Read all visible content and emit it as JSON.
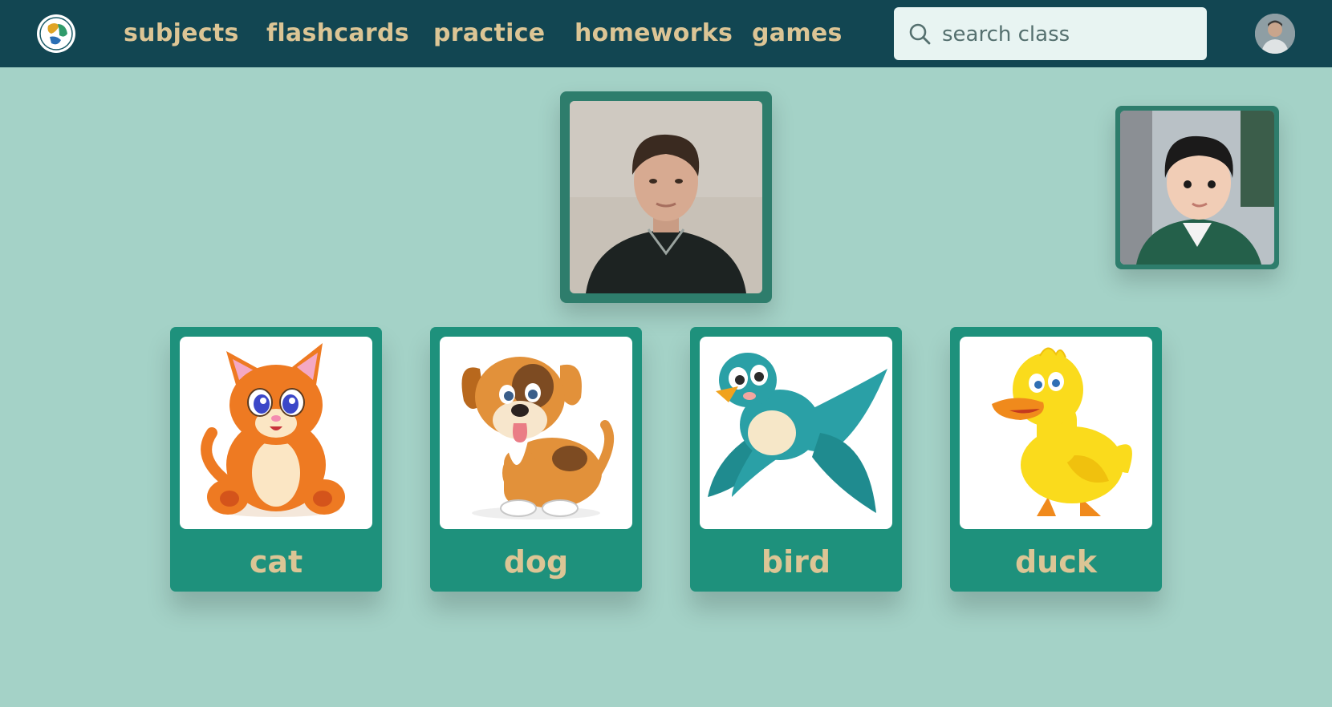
{
  "nav": {
    "logo_icon": "globe-logo-icon",
    "items": [
      {
        "label": "subjects"
      },
      {
        "label": "flashcards"
      },
      {
        "label": "practice"
      },
      {
        "label": "homeworks"
      },
      {
        "label": "games"
      }
    ]
  },
  "search": {
    "placeholder": "search class",
    "icon": "search-icon"
  },
  "user": {
    "avatar_icon": "user-avatar"
  },
  "video": {
    "teacher_icon": "teacher-video",
    "student_icon": "student-video"
  },
  "flashcards": [
    {
      "label": "cat",
      "icon": "cat-illustration"
    },
    {
      "label": "dog",
      "icon": "dog-illustration"
    },
    {
      "label": "bird",
      "icon": "bird-illustration"
    },
    {
      "label": "duck",
      "icon": "duck-illustration"
    }
  ],
  "colors": {
    "background": "#a4d2c7",
    "topbar": "#124652",
    "nav_text": "#dcc595",
    "card": "#1e917c",
    "video_frame": "#2e7d6c"
  }
}
